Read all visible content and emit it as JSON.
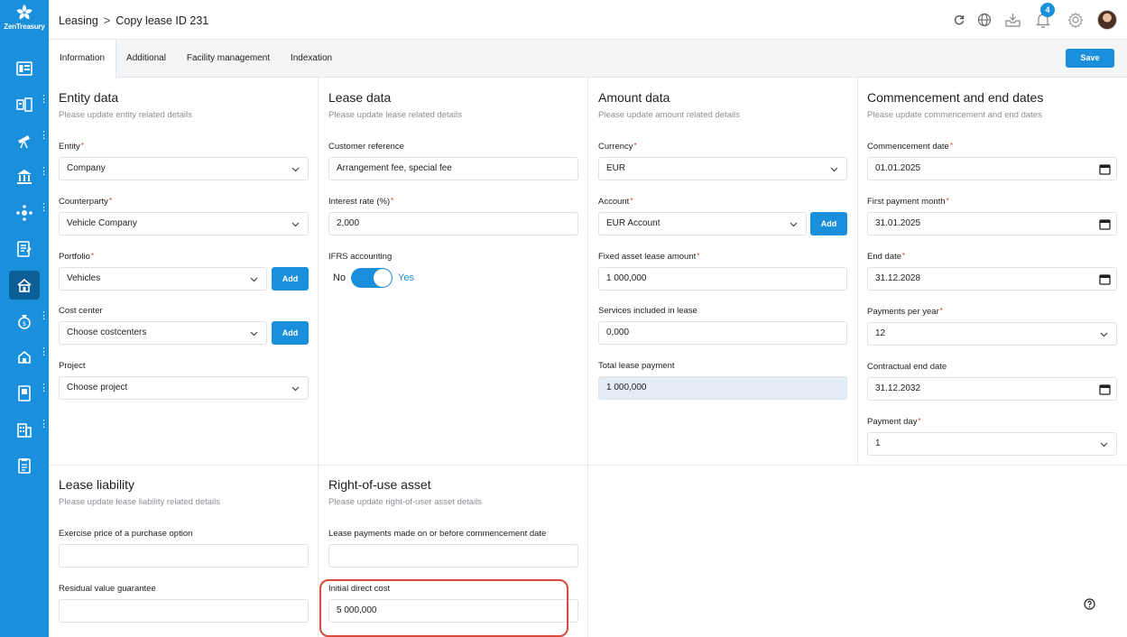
{
  "app": {
    "logo_text": "ZenTreasury"
  },
  "breadcrumb": {
    "parent": "Leasing",
    "current": "Copy lease ID 231"
  },
  "topbar": {
    "notification_count": "4"
  },
  "tabs": [
    {
      "label": "Information"
    },
    {
      "label": "Additional"
    },
    {
      "label": "Facility management"
    },
    {
      "label": "Indexation"
    }
  ],
  "save_label": "Save",
  "entity": {
    "title": "Entity data",
    "subtitle": "Please update entity related details",
    "entity_label": "Entity",
    "entity_value": "Company",
    "counterparty_label": "Counterparty",
    "counterparty_value": "Vehicle Company",
    "portfolio_label": "Portfolio",
    "portfolio_value": "Vehicles",
    "cost_center_label": "Cost center",
    "cost_center_value": "Choose costcenters",
    "project_label": "Project",
    "project_value": "Choose project",
    "add_label": "Add"
  },
  "lease": {
    "title": "Lease data",
    "subtitle": "Please update lease related details",
    "customer_ref_label": "Customer reference",
    "customer_ref_value": "Arrangement fee, special fee",
    "interest_label": "Interest rate (%)",
    "interest_value": "2,000",
    "ifrs_label": "IFRS accounting",
    "ifrs_no": "No",
    "ifrs_yes": "Yes",
    "ifrs_enabled": true
  },
  "amount": {
    "title": "Amount data",
    "subtitle": "Please update amount related details",
    "currency_label": "Currency",
    "currency_value": "EUR",
    "account_label": "Account",
    "account_value": "EUR Account",
    "add_label": "Add",
    "fixed_label": "Fixed asset lease amount",
    "fixed_value": "1 000,000",
    "services_label": "Services included in lease",
    "services_value": "0,000",
    "total_label": "Total lease payment",
    "total_value": "1 000,000"
  },
  "dates": {
    "title": "Commencement and end dates",
    "subtitle": "Please update commencement and end dates",
    "commencement_label": "Commencement date",
    "commencement_value": "01.01.2025",
    "first_payment_label": "First payment month",
    "first_payment_value": "31.01.2025",
    "end_label": "End date",
    "end_value": "31.12.2028",
    "payments_label": "Payments per year",
    "payments_value": "12",
    "contractual_label": "Contractual end date",
    "contractual_value": "31.12.2032",
    "payment_day_label": "Payment day",
    "payment_day_value": "1"
  },
  "liability": {
    "title": "Lease liability",
    "subtitle": "Please update lease liability related details",
    "exercise_label": "Exercise price of a purchase option",
    "exercise_value": "",
    "residual_label": "Residual value guarantee",
    "residual_value": ""
  },
  "rou": {
    "title": "Right-of-use asset",
    "subtitle": "Please update right-of-user asset details",
    "payments_before_label": "Lease payments made on or before commencement date",
    "payments_before_value": "",
    "initial_cost_label": "Initial direct cost",
    "initial_cost_value": "5 000,000"
  },
  "colors": {
    "accent": "#1a8fdc",
    "sidebar": "#1a8fdc",
    "highlight": "#d94b3a"
  }
}
